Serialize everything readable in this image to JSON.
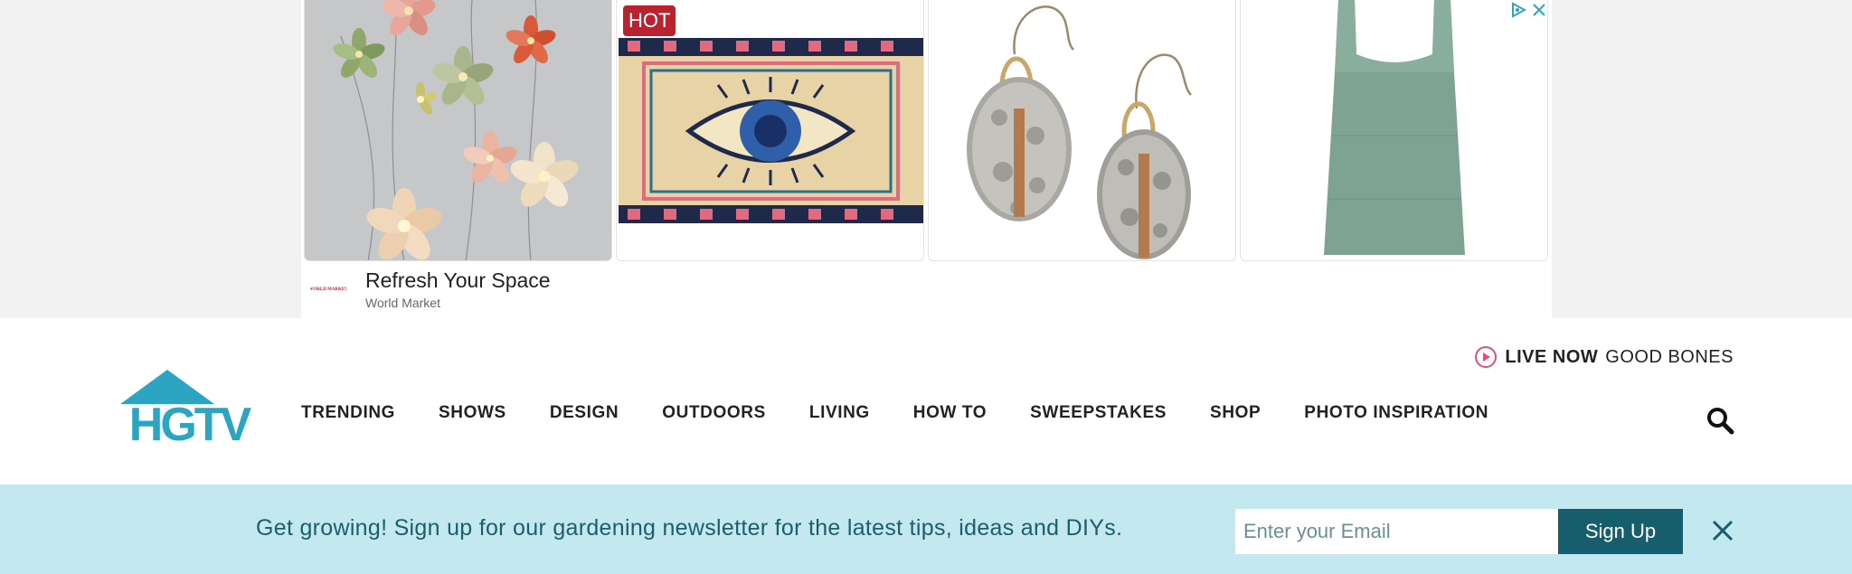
{
  "ad": {
    "badge": "HOT",
    "headline": "Refresh Your Space",
    "source": "World Market",
    "logo_text": "WORLD MARKET",
    "products": [
      {
        "icon": "flower-string-lights-image"
      },
      {
        "icon": "evil-eye-doormat-image"
      },
      {
        "icon": "hammered-oval-earrings-image"
      },
      {
        "icon": "green-linen-apron-image"
      }
    ],
    "adchoices_icons": [
      "adchoices-icon",
      "close-icon"
    ]
  },
  "header": {
    "live_label": "LIVE NOW",
    "live_show": "GOOD BONES",
    "logo_text": "HGTV",
    "brand_color": "#2ba5c1",
    "nav": [
      {
        "label": "TRENDING"
      },
      {
        "label": "SHOWS"
      },
      {
        "label": "DESIGN"
      },
      {
        "label": "OUTDOORS"
      },
      {
        "label": "LIVING"
      },
      {
        "label": "HOW TO"
      },
      {
        "label": "SWEEPSTAKES"
      },
      {
        "label": "SHOP"
      },
      {
        "label": "PHOTO INSPIRATION"
      }
    ],
    "search_icon": "search-icon"
  },
  "newsletter": {
    "text": "Get growing! Sign up for our gardening newsletter for the latest tips, ideas and DIYs.",
    "email_placeholder": "Enter your Email",
    "email_value": "",
    "submit_label": "Sign Up",
    "background": "#c3e8ef",
    "accent": "#165e6b"
  }
}
